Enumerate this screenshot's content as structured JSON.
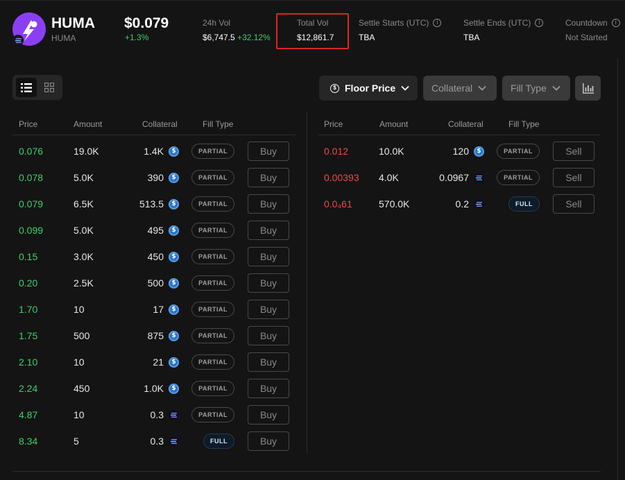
{
  "token": {
    "symbol": "HUMA",
    "name": "HUMA",
    "price": "$0.079",
    "change": "+1.3%",
    "logo_color": "#8b3ff5"
  },
  "stats": [
    {
      "label": "24h Vol",
      "value": "$6,747.5",
      "extra": "+32.12%",
      "info": false
    },
    {
      "label": "Total Vol",
      "value": "$12,861.7",
      "extra": "",
      "info": false
    },
    {
      "label": "Settle Starts (UTC)",
      "value": "TBA",
      "extra": "",
      "info": true
    },
    {
      "label": "Settle Ends (UTC)",
      "value": "TBA",
      "extra": "",
      "info": true
    },
    {
      "label": "Countdown",
      "value": "Not Started",
      "extra": "",
      "info": true
    }
  ],
  "toolbar": {
    "sort_label": "Floor Price",
    "collateral_label": "Collateral",
    "fill_type_label": "Fill Type",
    "view_modes": [
      "list-icon",
      "grid-icon"
    ],
    "chart_icon": "chart-icon"
  },
  "buy_table": {
    "headers": [
      "Price",
      "Amount",
      "Collateral",
      "Fill Type"
    ],
    "action_label": "Buy",
    "rows": [
      {
        "price": "0.076",
        "amount": "19.0K",
        "collateral": "1.4K",
        "coin": "usdc",
        "fill": "PARTIAL"
      },
      {
        "price": "0.078",
        "amount": "5.0K",
        "collateral": "390",
        "coin": "usdc",
        "fill": "PARTIAL"
      },
      {
        "price": "0.079",
        "amount": "6.5K",
        "collateral": "513.5",
        "coin": "usdc",
        "fill": "PARTIAL"
      },
      {
        "price": "0.099",
        "amount": "5.0K",
        "collateral": "495",
        "coin": "usdc",
        "fill": "PARTIAL"
      },
      {
        "price": "0.15",
        "amount": "3.0K",
        "collateral": "450",
        "coin": "usdc",
        "fill": "PARTIAL"
      },
      {
        "price": "0.20",
        "amount": "2.5K",
        "collateral": "500",
        "coin": "usdc",
        "fill": "PARTIAL"
      },
      {
        "price": "1.70",
        "amount": "10",
        "collateral": "17",
        "coin": "usdc",
        "fill": "PARTIAL"
      },
      {
        "price": "1.75",
        "amount": "500",
        "collateral": "875",
        "coin": "usdc",
        "fill": "PARTIAL"
      },
      {
        "price": "2.10",
        "amount": "10",
        "collateral": "21",
        "coin": "usdc",
        "fill": "PARTIAL"
      },
      {
        "price": "2.24",
        "amount": "450",
        "collateral": "1.0K",
        "coin": "usdc",
        "fill": "PARTIAL"
      },
      {
        "price": "4.87",
        "amount": "10",
        "collateral": "0.3",
        "coin": "sol",
        "fill": "PARTIAL"
      },
      {
        "price": "8.34",
        "amount": "5",
        "collateral": "0.3",
        "coin": "sol",
        "fill": "FULL"
      }
    ]
  },
  "sell_table": {
    "headers": [
      "Price",
      "Amount",
      "Collateral",
      "Fill Type"
    ],
    "action_label": "Sell",
    "rows": [
      {
        "price": "0.012",
        "amount": "10.0K",
        "collateral": "120",
        "coin": "usdc",
        "fill": "PARTIAL"
      },
      {
        "price": "0.00393",
        "amount": "4.0K",
        "collateral": "0.0967",
        "coin": "sol",
        "fill": "PARTIAL"
      },
      {
        "price": "0.0₄61",
        "amount": "570.0K",
        "collateral": "0.2",
        "coin": "sol",
        "fill": "FULL"
      }
    ]
  },
  "colors": {
    "buy": "#3fcf6a",
    "sell": "#f04646",
    "highlight": "#e02424",
    "background": "#141414"
  }
}
